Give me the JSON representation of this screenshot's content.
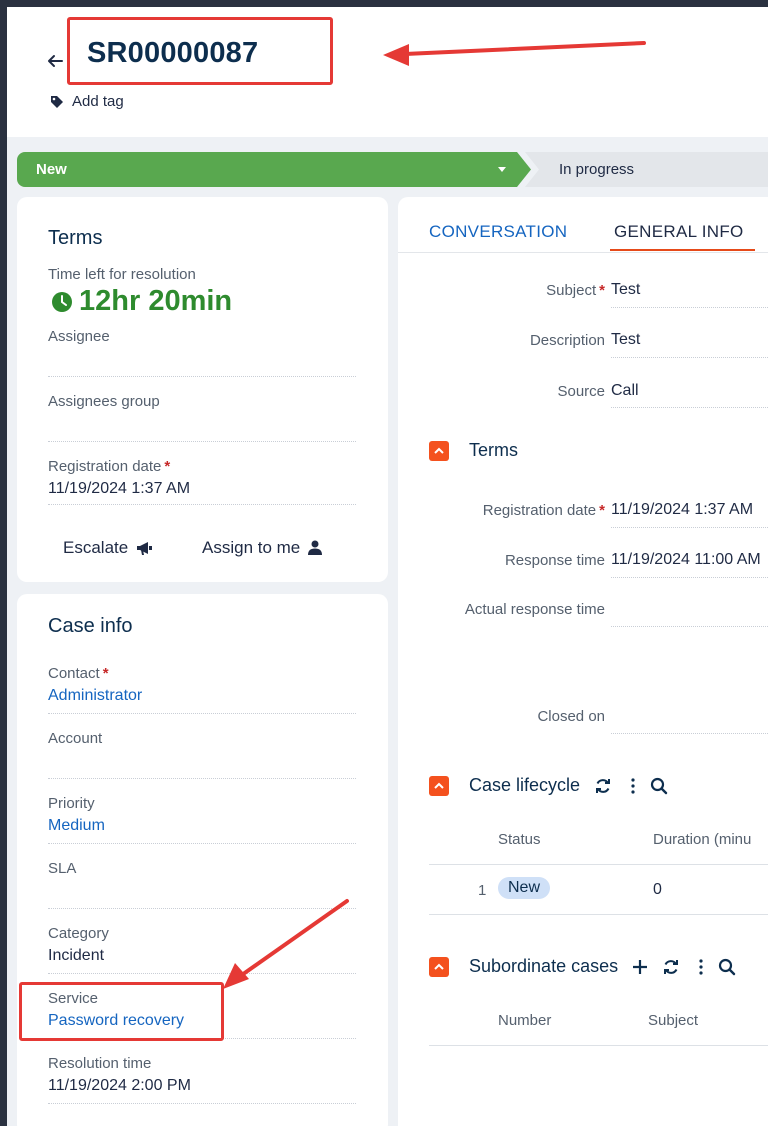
{
  "header": {
    "case_number": "SR00000087",
    "add_tag": "Add tag"
  },
  "stages": {
    "current": "New",
    "next": "In progress"
  },
  "terms_card": {
    "title": "Terms",
    "time_left_label": "Time left for resolution",
    "time_left_value": "12hr 20min",
    "assignee_label": "Assignee",
    "assignees_group_label": "Assignees group",
    "registration_date_label": "Registration date",
    "registration_date_value": "11/19/2024 1:37 AM",
    "escalate_label": "Escalate",
    "assign_to_me_label": "Assign to me"
  },
  "case_info": {
    "title": "Case info",
    "contact_label": "Contact",
    "contact_value": "Administrator",
    "account_label": "Account",
    "priority_label": "Priority",
    "priority_value": "Medium",
    "sla_label": "SLA",
    "category_label": "Category",
    "category_value": "Incident",
    "service_label": "Service",
    "service_value": "Password recovery",
    "resolution_time_label": "Resolution time",
    "resolution_time_value": "11/19/2024 2:00 PM"
  },
  "tabs": [
    {
      "label": "CONVERSATION"
    },
    {
      "label": "GENERAL INFO"
    }
  ],
  "general": {
    "subject_label": "Subject",
    "subject_value": "Test",
    "description_label": "Description",
    "description_value": "Test",
    "source_label": "Source",
    "source_value": "Call"
  },
  "terms_section": {
    "title": "Terms",
    "registration_date_label": "Registration date",
    "registration_date_value": "11/19/2024 1:37 AM",
    "response_time_label": "Response time",
    "response_time_value": "11/19/2024 11:00 AM",
    "actual_response_time_label": "Actual response time",
    "closed_on_label": "Closed on"
  },
  "lifecycle": {
    "title": "Case lifecycle",
    "columns": [
      "Status",
      "Duration (minu"
    ],
    "rows": [
      {
        "num": "1",
        "status": "New",
        "duration": "0"
      }
    ]
  },
  "subordinate": {
    "title": "Subordinate cases",
    "columns": [
      "Number",
      "Subject"
    ]
  },
  "colors": {
    "accent_orange": "#f4511e",
    "stage_green": "#59a84f",
    "link_blue": "#1565c0",
    "annotation_red": "#e53935"
  }
}
